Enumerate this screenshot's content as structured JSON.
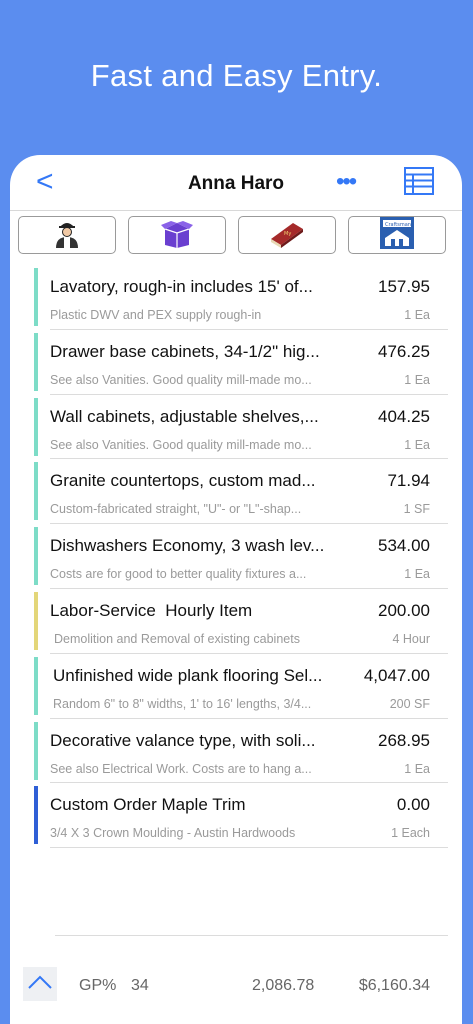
{
  "headline": "Fast and Easy Entry.",
  "nav": {
    "title": "Anna Haro",
    "back": "<",
    "more": "•••"
  },
  "tabs": [
    {
      "name": "worker-icon",
      "label": ""
    },
    {
      "name": "box-icon",
      "label": ""
    },
    {
      "name": "book-icon",
      "label": "My"
    },
    {
      "name": "craftsman-icon",
      "label": "Craftsman"
    }
  ],
  "items": [
    {
      "title": "Lavatory, rough-in includes 15' of...",
      "subtitle": "Plastic DWV and PEX supply rough-in",
      "amount": "157.95",
      "qty": "1 Ea",
      "color": "#7ddcc7"
    },
    {
      "title": "Drawer base cabinets, 34-1/2\" hig...",
      "subtitle": "See also Vanities. Good quality mill-made mo...",
      "amount": "476.25",
      "qty": "1 Ea",
      "color": "#7ddcc7"
    },
    {
      "title": "Wall cabinets, adjustable shelves,...",
      "subtitle": "See also Vanities. Good quality mill-made mo...",
      "amount": "404.25",
      "qty": "1 Ea",
      "color": "#7ddcc7"
    },
    {
      "title": "Granite countertops, custom mad...",
      "subtitle": "Custom-fabricated straight, \"U\"- or \"L\"-shap...",
      "amount": "71.94",
      "qty": "1 SF",
      "color": "#7ddcc7"
    },
    {
      "title": "Dishwashers Economy, 3 wash lev...",
      "subtitle": "Costs are for good to better quality fixtures a...",
      "amount": "534.00",
      "qty": "1 Ea",
      "color": "#7ddcc7"
    },
    {
      "title": "Labor-Service  Hourly Item",
      "subtitle": "Demolition and Removal of existing cabinets",
      "amount": "200.00",
      "qty": "4 Hour",
      "color": "#e3d679"
    },
    {
      "title": "Unfinished wide plank flooring Sel...",
      "subtitle": "Random 6\" to 8\" widths, 1' to 16' lengths, 3/4...",
      "amount": "4,047.00",
      "qty": "200 SF",
      "color": "#7ddcc7"
    },
    {
      "title": "Decorative valance type, with soli...",
      "subtitle": "See also Electrical Work. Costs are to hang a...",
      "amount": "268.95",
      "qty": "1 Ea",
      "color": "#7ddcc7"
    },
    {
      "title": "Custom Order Maple Trim",
      "subtitle": "3/4 X 3 Crown Moulding - Austin Hardwoods",
      "amount": "0.00",
      "qty": "1 Each",
      "color": "#2f5fd6"
    }
  ],
  "footer": {
    "gp_label": "GP%",
    "gp_value": "34",
    "cost": "2,086.78",
    "total": "$6,160.34"
  },
  "colors": {
    "accent": "#3478f6",
    "background": "#5b8def"
  }
}
